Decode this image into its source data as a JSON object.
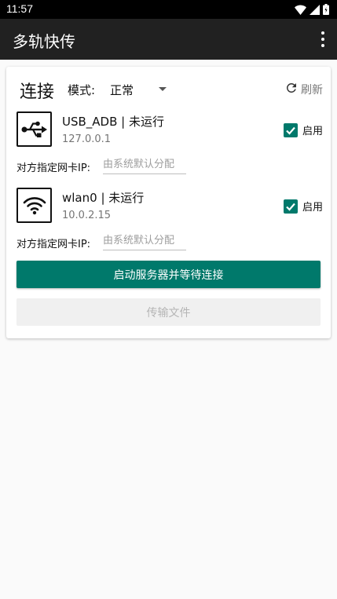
{
  "status_bar": {
    "time": "11:57",
    "icons": [
      "wifi-icon",
      "signal-icon",
      "battery-icon"
    ]
  },
  "app_bar": {
    "title": "多轨快传",
    "menu_icon": "more-vert-icon"
  },
  "connection": {
    "title": "连接",
    "mode_label": "模式:",
    "mode_value": "正常",
    "refresh_label": "刷新"
  },
  "interfaces": [
    {
      "icon": "usb-icon",
      "name": "USB_ADB | 未运行",
      "ip": "127.0.0.1",
      "enabled": true,
      "enabled_label": "启用",
      "nic_label": "对方指定网卡IP:",
      "nic_placeholder": "由系统默认分配",
      "nic_value": ""
    },
    {
      "icon": "wifi-icon",
      "name": "wlan0 | 未运行",
      "ip": "10.0.2.15",
      "enabled": true,
      "enabled_label": "启用",
      "nic_label": "对方指定网卡IP:",
      "nic_placeholder": "由系统默认分配",
      "nic_value": ""
    }
  ],
  "actions": {
    "start_label": "启动服务器并等待连接",
    "transfer_label": "传输文件"
  },
  "colors": {
    "accent": "#00796b",
    "app_bar": "#212121",
    "status_bar": "#000000"
  }
}
